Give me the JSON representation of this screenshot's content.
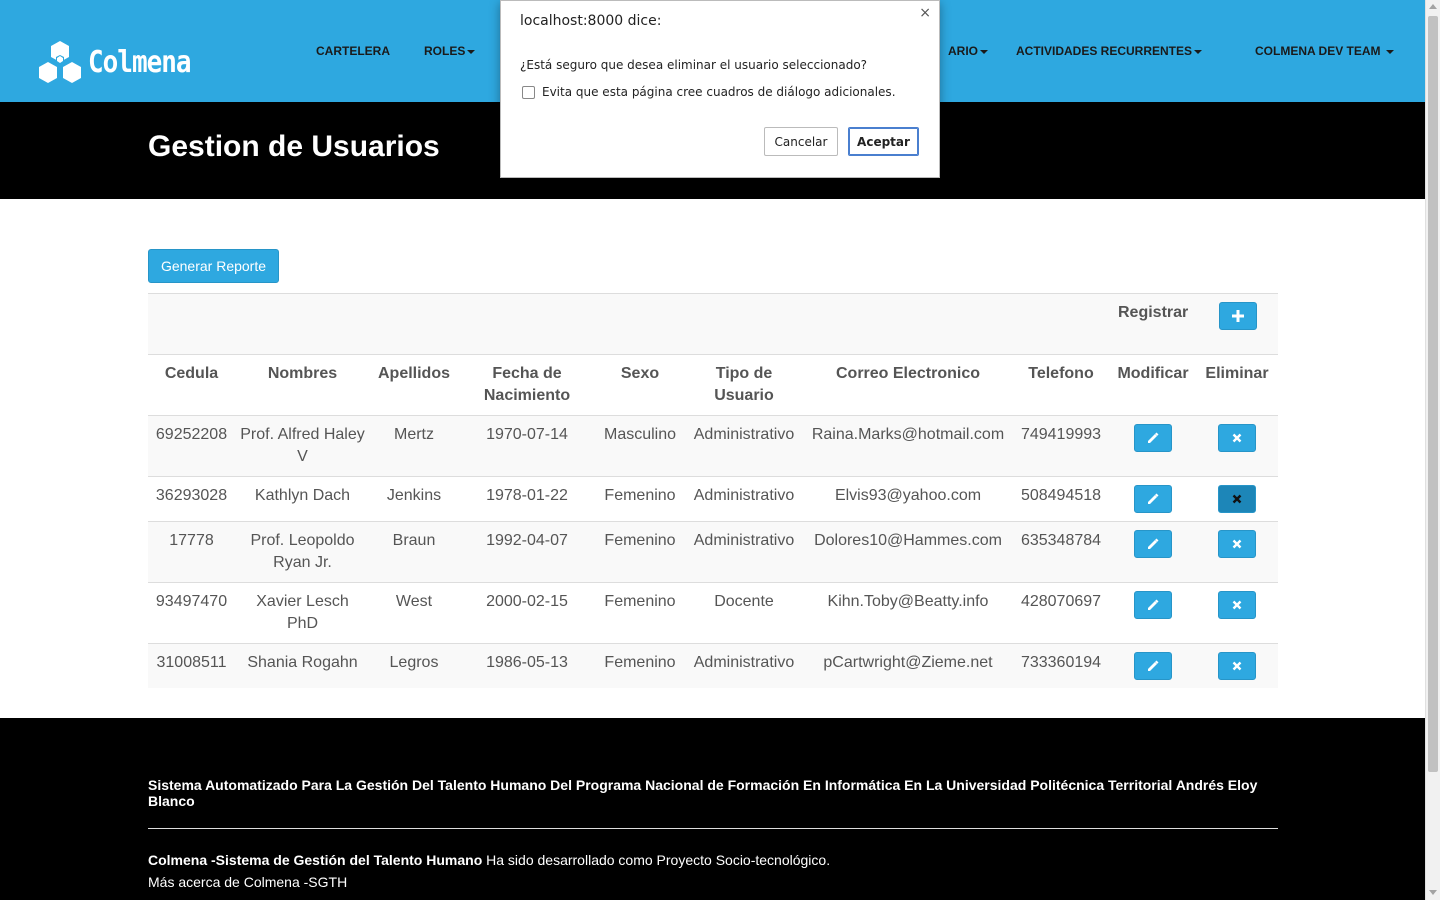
{
  "brand": {
    "name": "Colmena"
  },
  "nav": {
    "cartelera": "CARTELERA",
    "roles": "ROLES",
    "usuario_partial": "ARIO",
    "actividades": "ACTIVIDADES RECURRENTES",
    "team": "COLMENA DEV TEAM"
  },
  "page": {
    "title": "Gestion de Usuarios"
  },
  "actions": {
    "report_label": "Generar Reporte",
    "register_label": "Registrar"
  },
  "table": {
    "headers": [
      "Cedula",
      "Nombres",
      "Apellidos",
      "Fecha de Nacimiento",
      "Sexo",
      "Tipo de Usuario",
      "Correo Electronico",
      "Telefono",
      "Modificar",
      "Eliminar"
    ],
    "rows": [
      [
        "69252208",
        "Prof. Alfred Haley V",
        "Mertz",
        "1970-07-14",
        "Masculino",
        "Administrativo",
        "Raina.Marks@hotmail.com",
        "749419993"
      ],
      [
        "36293028",
        "Kathlyn Dach",
        "Jenkins",
        "1978-01-22",
        "Femenino",
        "Administrativo",
        "Elvis93@yahoo.com",
        "508494518"
      ],
      [
        "17778",
        "Prof. Leopoldo Ryan Jr.",
        "Braun",
        "1992-04-07",
        "Femenino",
        "Administrativo",
        "Dolores10@Hammes.com",
        "635348784"
      ],
      [
        "93497470",
        "Xavier Lesch PhD",
        "West",
        "2000-02-15",
        "Femenino",
        "Docente",
        "Kihn.Toby@Beatty.info",
        "428070697"
      ],
      [
        "31008511",
        "Shania Rogahn",
        "Legros",
        "1986-05-13",
        "Femenino",
        "Administrativo",
        "pCartwright@Zieme.net",
        "733360194"
      ]
    ]
  },
  "footer": {
    "title": "Sistema Automatizado Para La Gestión Del Talento Humano Del Programa Nacional de Formación En Informática En La Universidad Politécnica Territorial Andrés Eloy Blanco",
    "line1_bold": "Colmena -Sistema de Gestión del Talento Humano",
    "line1_rest": " Ha sido desarrollado como Proyecto Socio-tecnológico.",
    "line2": "Más acerca de Colmena -SGTH"
  },
  "dialog": {
    "title": "localhost:8000 dice:",
    "close": "×",
    "message": "¿Está seguro que desea eliminar el usuario seleccionado?",
    "checkbox_label": "Evita que esta página cree cuadros de diálogo adicionales.",
    "cancel_label": "Cancelar",
    "ok_label": "Aceptar"
  },
  "icons": {
    "logo": "hexagon-hive-logo",
    "add": "plus-icon",
    "edit": "pencil-icon",
    "delete": "x-icon"
  },
  "colors": {
    "primary": "#2ea8e0",
    "dark": "#000000",
    "text": "#555555"
  }
}
